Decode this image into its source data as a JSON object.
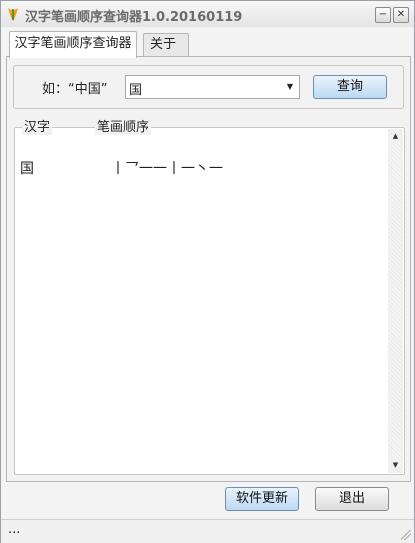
{
  "window": {
    "title": "汉字笔画顺序查询器1.0.20160119",
    "minimize_label": "−",
    "close_label": "✕"
  },
  "tabs": [
    {
      "label": "汉字笔画顺序查询器",
      "active": true
    },
    {
      "label": "关于",
      "active": false
    }
  ],
  "query": {
    "hint": "如：“中国”",
    "value": "国",
    "submit_label": "查询"
  },
  "results": {
    "columns": [
      "汉字",
      "笔画顺序"
    ],
    "rows": [
      {
        "char": "国",
        "strokes": "丨乛一一丨一丶一"
      }
    ]
  },
  "footer": {
    "update_label": "软件更新",
    "exit_label": "退出",
    "status_text": "..."
  },
  "colors": {
    "button_gradient_top": "#eaf4fc",
    "button_gradient_bottom": "#bcd8f2",
    "window_bg": "#f3f3f3"
  }
}
